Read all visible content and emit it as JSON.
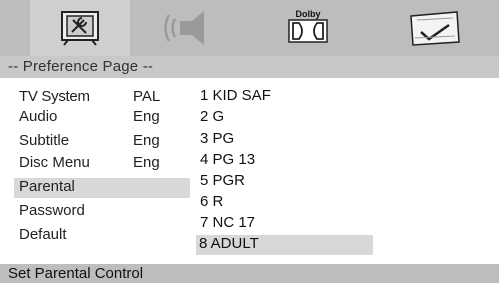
{
  "tabs": [
    {
      "icon": "settings-tools-icon"
    },
    {
      "icon": "speaker-icon"
    },
    {
      "icon": "dolby-icon",
      "label": "Dolby"
    },
    {
      "icon": "preference-check-icon"
    }
  ],
  "header": {
    "title": "-- Preference Page --"
  },
  "menu": [
    {
      "label": "TV System",
      "value": "PAL"
    },
    {
      "label": "Audio",
      "value": "Eng"
    },
    {
      "label": "Subtitle",
      "value": "Eng"
    },
    {
      "label": "Disc Menu",
      "value": "Eng"
    },
    {
      "label": "Parental",
      "value": ""
    },
    {
      "label": "Password",
      "value": ""
    },
    {
      "label": "Default",
      "value": ""
    }
  ],
  "options": [
    "1  KID SAF",
    "2  G",
    "3  PG",
    "4  PG  13",
    "5  PGR",
    "6  R",
    "7  NC 17",
    "8 ADULT"
  ],
  "footer": {
    "status": "Set Parental Control"
  },
  "colors": {
    "bar": "#bdbdbd",
    "highlight": "#d8d8d8"
  }
}
